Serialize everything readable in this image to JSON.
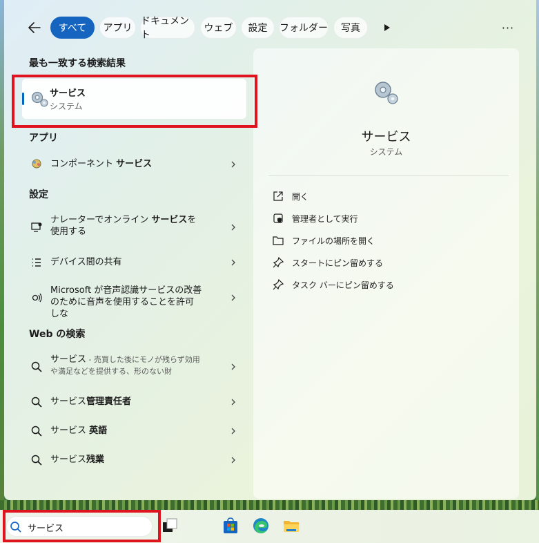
{
  "tabs": [
    {
      "label": "すべて",
      "active": true
    },
    {
      "label": "アプリ"
    },
    {
      "label": "ドキュメント"
    },
    {
      "label": "ウェブ"
    },
    {
      "label": "設定"
    },
    {
      "label": "フォルダー"
    },
    {
      "label": "写真"
    }
  ],
  "icons": {
    "back": "arrow-left-icon",
    "more_tabs": "play-icon",
    "menu": "more-dots-icon"
  },
  "menu_dots": "···",
  "best_match": {
    "heading": "最も一致する検索結果",
    "title": "サービス",
    "subtitle": "システム"
  },
  "apps": {
    "heading": "アプリ",
    "items": [
      {
        "pre": "コンポーネント ",
        "bold": "サービス",
        "post": ""
      }
    ]
  },
  "settings": {
    "heading": "設定",
    "items": [
      {
        "pre": "ナレーターでオンライン ",
        "bold": "サービス",
        "post": "を使用する"
      },
      {
        "pre": "デバイス間の共有",
        "bold": "",
        "post": ""
      },
      {
        "pre": "Microsoft が音声認識サービスの改善のために音声を使用することを許可しな",
        "bold": "",
        "post": ""
      }
    ]
  },
  "web": {
    "heading": "Web の検索",
    "items": [
      {
        "pre": "サービス",
        "bold": "",
        "post": "",
        "sub": " - 売買した後にモノが残らず効用や満足などを提供する、形のない財"
      },
      {
        "pre": "サービス",
        "bold": "管理責任者",
        "post": ""
      },
      {
        "pre": "サービス ",
        "bold": "英語",
        "post": ""
      },
      {
        "pre": "サービス",
        "bold": "残業",
        "post": ""
      }
    ]
  },
  "preview": {
    "title": "サービス",
    "subtitle": "システム",
    "actions": [
      {
        "label": "開く",
        "icon": "open-external-icon"
      },
      {
        "label": "管理者として実行",
        "icon": "shield-admin-icon"
      },
      {
        "label": "ファイルの場所を開く",
        "icon": "folder-icon"
      },
      {
        "label": "スタートにピン留めする",
        "icon": "pin-icon"
      },
      {
        "label": "タスク バーにピン留めする",
        "icon": "pin-icon"
      }
    ]
  },
  "taskbar": {
    "search_value": "サービス",
    "apps": [
      "task-view-icon",
      "store-icon",
      "edge-icon",
      "file-explorer-icon"
    ]
  },
  "colors": {
    "accent": "#1565c0",
    "highlight": "#e0141e"
  }
}
